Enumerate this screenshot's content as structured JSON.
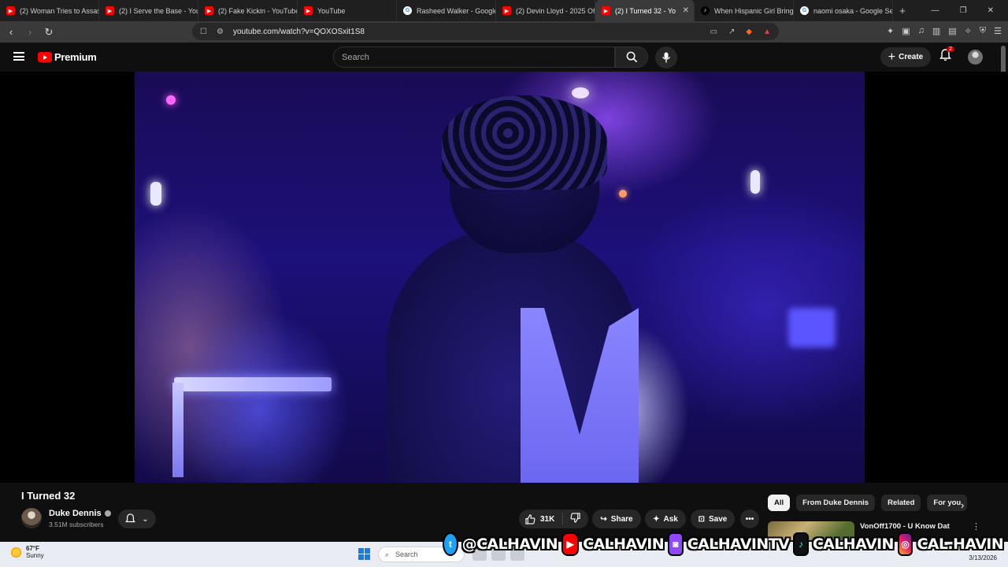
{
  "browser": {
    "tabs": [
      {
        "label": "(2) Woman Tries to Assas",
        "icon": "youtube-icon"
      },
      {
        "label": "(2) I Serve the Base - YouT",
        "icon": "youtube-icon"
      },
      {
        "label": "(2) Fake Kickin - YouTube",
        "icon": "youtube-icon"
      },
      {
        "label": "YouTube",
        "icon": "youtube-icon"
      },
      {
        "label": "Rasheed Walker - Google",
        "icon": "google-icon"
      },
      {
        "label": "(2) Devin Lloyd - 2025 Off",
        "icon": "youtube-icon"
      },
      {
        "label": "(2) I Turned 32 - Yo",
        "icon": "youtube-icon",
        "active": true
      },
      {
        "label": "When Hispanic Girl Brings",
        "icon": "tiktok-icon"
      },
      {
        "label": "naomi osaka - Google Sea",
        "icon": "google-icon"
      }
    ],
    "url": "youtube.com/watch?v=QOXOSxit1S8"
  },
  "youtube": {
    "brand": "Premium",
    "search_placeholder": "Search",
    "create_label": "Create",
    "notification_count": "2"
  },
  "video": {
    "title": "I Turned 32",
    "channel": "Duke Dennis",
    "subscribers": "3.51M subscribers",
    "likes": "31K",
    "share_label": "Share",
    "ask_label": "Ask",
    "save_label": "Save"
  },
  "sidebar": {
    "chips": [
      "All",
      "From Duke Dennis",
      "Related",
      "For you"
    ],
    "first_rec_title": "VonOff1700 - U Know Dat"
  },
  "taskbar": {
    "temperature": "67°F",
    "weather": "Sunny",
    "weather_badge": "1",
    "search_label": "Search",
    "date": "3/13/2026"
  },
  "overlay": {
    "twitter": "@CALHAVIN",
    "youtube": "CALHAVIN",
    "twitch": "CALHAVINTV",
    "tiktok": "CALHAVIN",
    "instagram": "CAL.HAVIN"
  },
  "colors": {
    "youtube_red": "#ff0000",
    "background": "#0f0f0f",
    "video_tint": "#1c107a"
  }
}
